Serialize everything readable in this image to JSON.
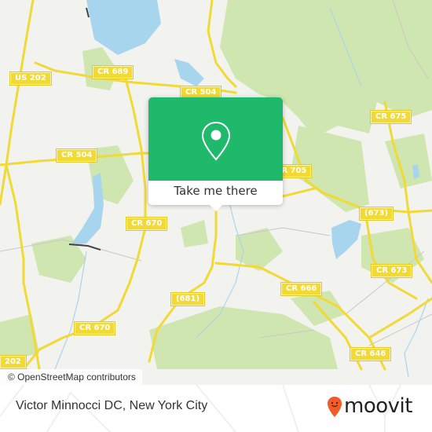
{
  "map": {
    "road_labels": [
      {
        "id": "us202-top",
        "text": "US 202"
      },
      {
        "id": "cr689",
        "text": "CR 689"
      },
      {
        "id": "cr504-top",
        "text": "CR 504"
      },
      {
        "id": "cr504-left",
        "text": "CR 504"
      },
      {
        "id": "cr675",
        "text": "CR 675"
      },
      {
        "id": "cr705",
        "text": "CR 705"
      },
      {
        "id": "cr673-paren",
        "text": "(673)"
      },
      {
        "id": "cr670-top",
        "text": "CR 670"
      },
      {
        "id": "cr673",
        "text": "CR 673"
      },
      {
        "id": "cr666",
        "text": "CR 666"
      },
      {
        "id": "cr681",
        "text": "(681)"
      },
      {
        "id": "cr670-bottom",
        "text": "CR 670"
      },
      {
        "id": "us202-bottom",
        "text": "202"
      },
      {
        "id": "cr646",
        "text": "CR 646"
      }
    ],
    "attribution": "© OpenStreetMap contributors",
    "colors": {
      "land": "#f2f2ee",
      "park": "#cfe6b0",
      "water": "#a8d5ee",
      "road": "#f1d936"
    }
  },
  "popup": {
    "icon": "location-pin-icon",
    "button_label": "Take me there",
    "accent": "#1fb96b"
  },
  "footer": {
    "place_name": "Victor Minnocci DC, New York City",
    "brand": "moovit",
    "brand_color": "#f15a29"
  }
}
